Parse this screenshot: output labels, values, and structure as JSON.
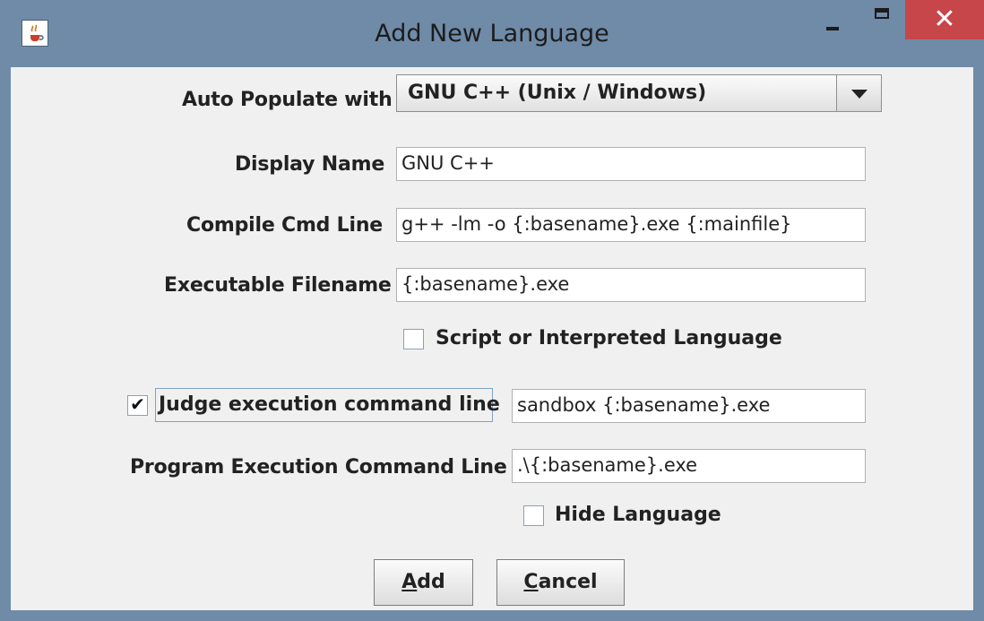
{
  "window": {
    "title": "Add New Language",
    "close_symbol": "✕",
    "app_icon": "java-coffee-icon"
  },
  "form": {
    "auto_populate": {
      "label": "Auto Populate with",
      "selected": "GNU C++ (Unix / Windows)"
    },
    "display_name": {
      "label": "Display Name",
      "value": "GNU C++"
    },
    "compile_cmd": {
      "label": "Compile Cmd Line",
      "value": "g++ -lm -o {:basename}.exe {:mainfile}"
    },
    "executable": {
      "label": "Executable Filename",
      "value": "{:basename}.exe"
    },
    "script_checkbox": {
      "label": "Script or Interpreted Language",
      "checked": false
    },
    "judge_checkbox": {
      "label": "Judge execution command line",
      "checked": true,
      "value": "sandbox {:basename}.exe"
    },
    "program_exec": {
      "label": "Program Execution Command Line",
      "value": ".\\{:basename}.exe"
    },
    "hide_checkbox": {
      "label": "Hide Language",
      "checked": false
    }
  },
  "buttons": {
    "add": {
      "underline": "A",
      "rest": "dd"
    },
    "cancel": {
      "underline": "C",
      "rest": "ancel"
    }
  },
  "colors": {
    "window_frame": "#6f8ba8",
    "close_button": "#c7464a",
    "panel": "#f0f0f0"
  }
}
